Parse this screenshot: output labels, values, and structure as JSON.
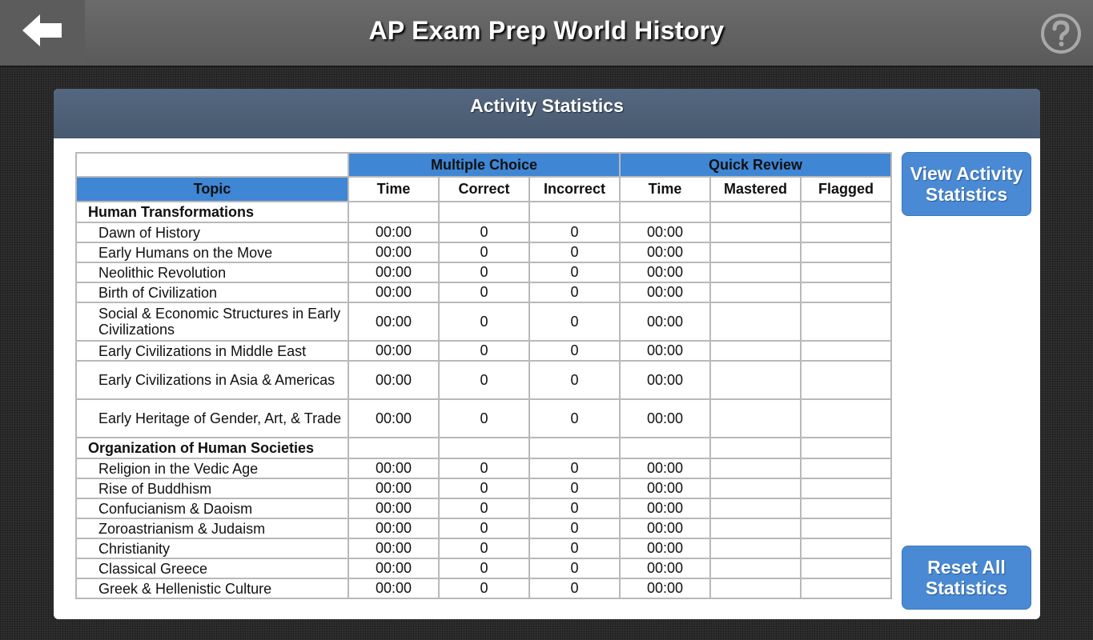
{
  "header": {
    "title": "AP Exam Prep World History",
    "back_icon": "back-arrow-icon",
    "help_icon": "help-icon"
  },
  "panel": {
    "title": "Activity Statistics"
  },
  "table": {
    "group_headers": [
      "Multiple Choice",
      "Quick Review"
    ],
    "columns": [
      "Topic",
      "Time",
      "Correct",
      "Incorrect",
      "Time",
      "Mastered",
      "Flagged"
    ],
    "sections": [
      {
        "title": "Human Transformations",
        "rows": [
          {
            "topic": "Dawn of History",
            "mc_time": "00:00",
            "correct": "0",
            "incorrect": "0",
            "qr_time": "00:00",
            "mastered": "",
            "flagged": ""
          },
          {
            "topic": "Early Humans on the Move",
            "mc_time": "00:00",
            "correct": "0",
            "incorrect": "0",
            "qr_time": "00:00",
            "mastered": "",
            "flagged": ""
          },
          {
            "topic": "Neolithic Revolution",
            "mc_time": "00:00",
            "correct": "0",
            "incorrect": "0",
            "qr_time": "00:00",
            "mastered": "",
            "flagged": ""
          },
          {
            "topic": "Birth of Civilization",
            "mc_time": "00:00",
            "correct": "0",
            "incorrect": "0",
            "qr_time": "00:00",
            "mastered": "",
            "flagged": ""
          },
          {
            "topic": "Social & Economic Structures in Early Civilizations",
            "mc_time": "00:00",
            "correct": "0",
            "incorrect": "0",
            "qr_time": "00:00",
            "mastered": "",
            "flagged": ""
          },
          {
            "topic": "Early Civilizations in Middle East",
            "mc_time": "00:00",
            "correct": "0",
            "incorrect": "0",
            "qr_time": "00:00",
            "mastered": "",
            "flagged": ""
          },
          {
            "topic": "Early Civilizations in Asia & Americas",
            "mc_time": "00:00",
            "correct": "0",
            "incorrect": "0",
            "qr_time": "00:00",
            "mastered": "",
            "flagged": ""
          },
          {
            "topic": "Early Heritage of Gender, Art, & Trade",
            "mc_time": "00:00",
            "correct": "0",
            "incorrect": "0",
            "qr_time": "00:00",
            "mastered": "",
            "flagged": ""
          }
        ]
      },
      {
        "title": "Organization of Human Societies",
        "rows": [
          {
            "topic": "Religion in the Vedic Age",
            "mc_time": "00:00",
            "correct": "0",
            "incorrect": "0",
            "qr_time": "00:00",
            "mastered": "",
            "flagged": ""
          },
          {
            "topic": "Rise of Buddhism",
            "mc_time": "00:00",
            "correct": "0",
            "incorrect": "0",
            "qr_time": "00:00",
            "mastered": "",
            "flagged": ""
          },
          {
            "topic": "Confucianism & Daoism",
            "mc_time": "00:00",
            "correct": "0",
            "incorrect": "0",
            "qr_time": "00:00",
            "mastered": "",
            "flagged": ""
          },
          {
            "topic": "Zoroastrianism & Judaism",
            "mc_time": "00:00",
            "correct": "0",
            "incorrect": "0",
            "qr_time": "00:00",
            "mastered": "",
            "flagged": ""
          },
          {
            "topic": "Christianity",
            "mc_time": "00:00",
            "correct": "0",
            "incorrect": "0",
            "qr_time": "00:00",
            "mastered": "",
            "flagged": ""
          },
          {
            "topic": "Classical Greece",
            "mc_time": "00:00",
            "correct": "0",
            "incorrect": "0",
            "qr_time": "00:00",
            "mastered": "",
            "flagged": ""
          },
          {
            "topic": "Greek & Hellenistic Culture",
            "mc_time": "00:00",
            "correct": "0",
            "incorrect": "0",
            "qr_time": "00:00",
            "mastered": "",
            "flagged": ""
          }
        ]
      }
    ]
  },
  "buttons": {
    "view_activity": "View Activity Statistics",
    "reset_all": "Reset All Statistics"
  },
  "colors": {
    "header_bar": "#5f5f5f",
    "panel_header": "#4e6178",
    "table_header_blue": "#3f86d4",
    "button_blue": "#4a8ad4"
  }
}
